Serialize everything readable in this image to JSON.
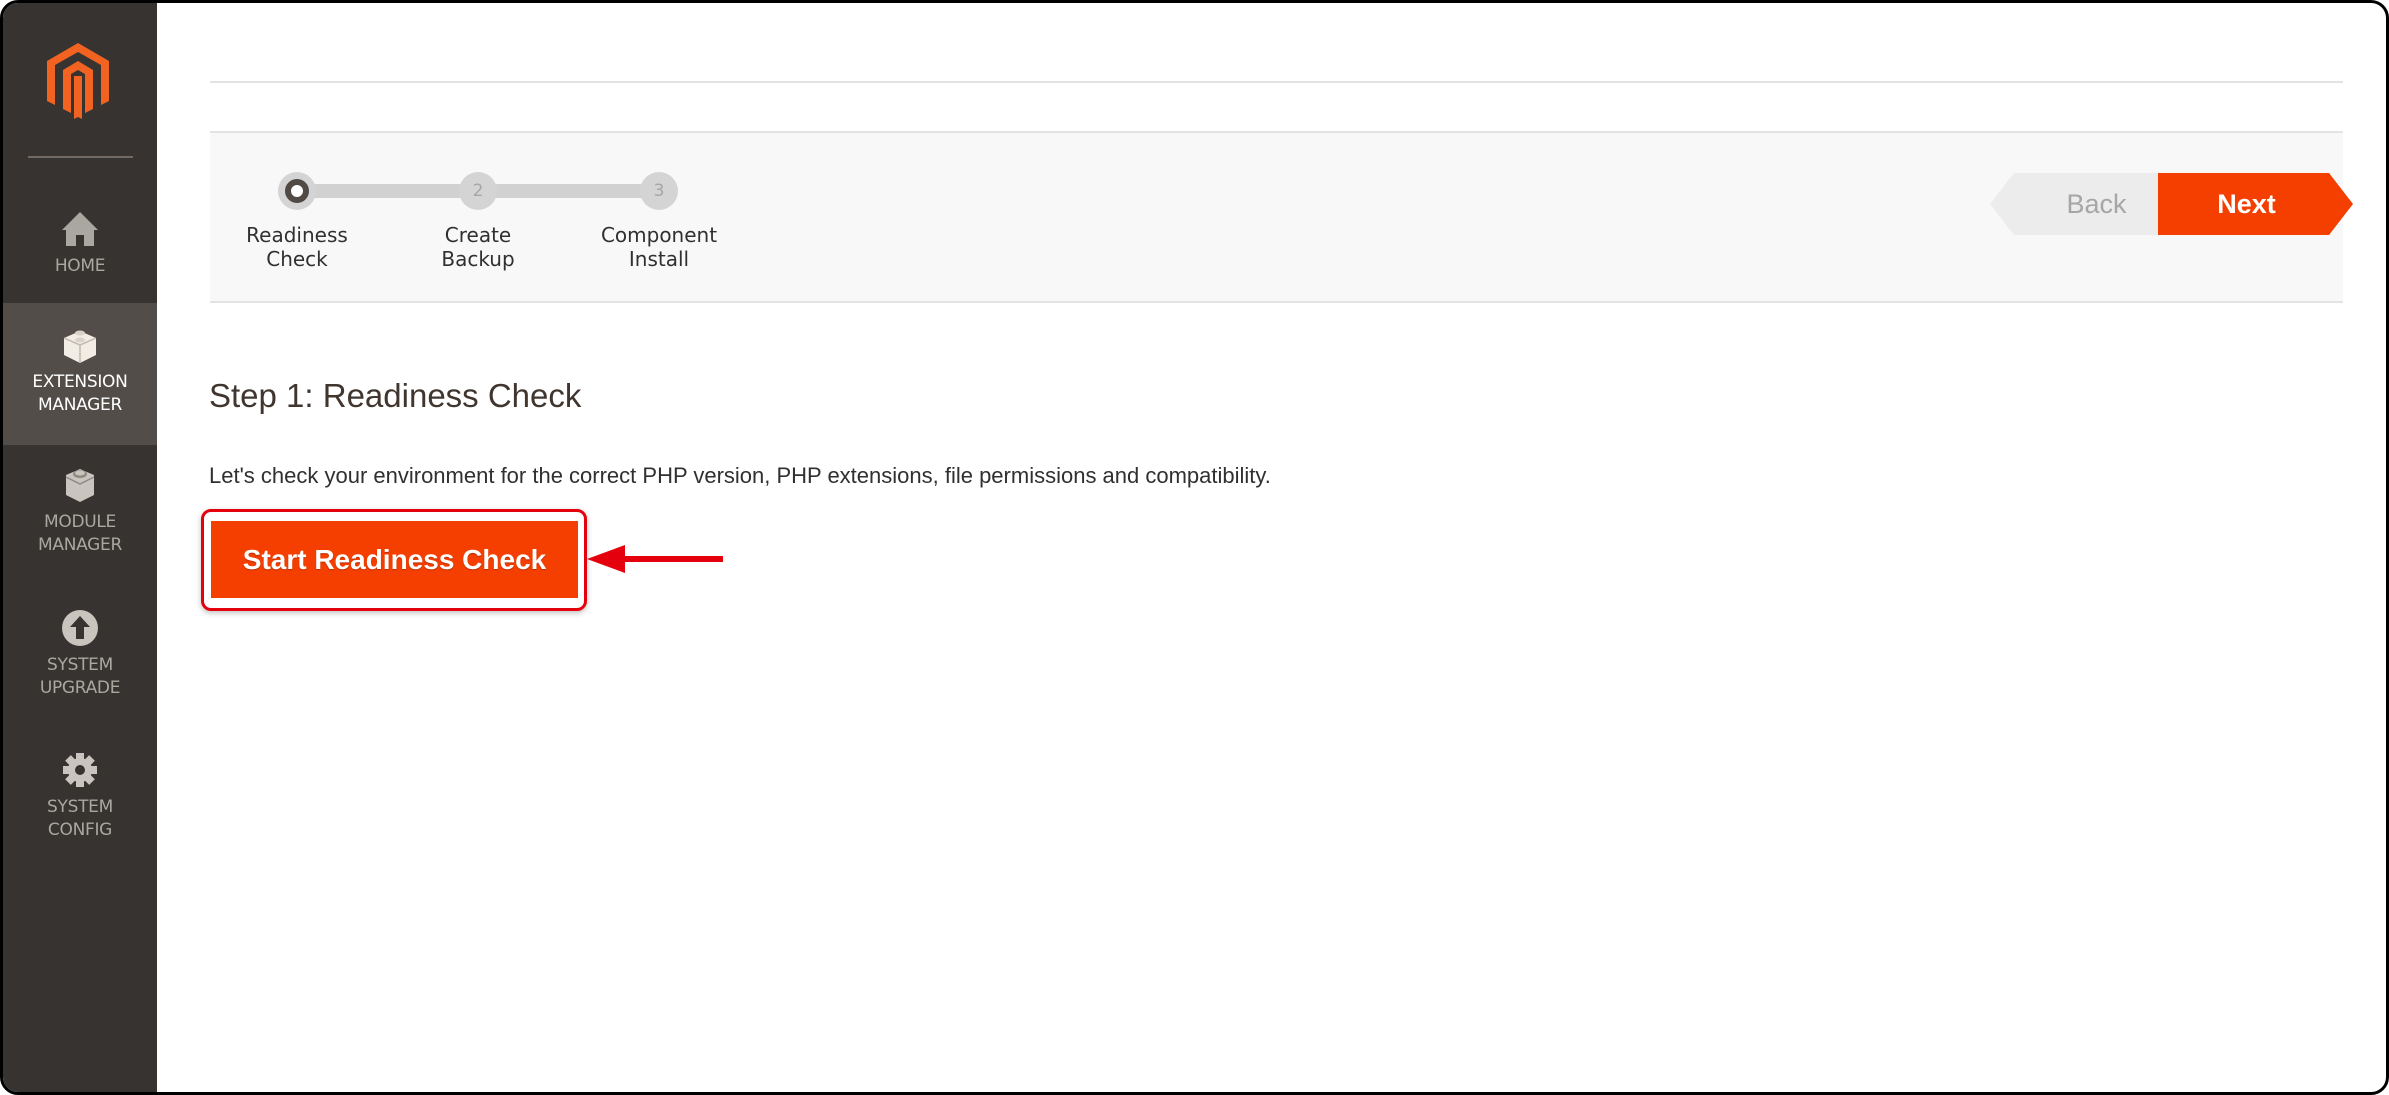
{
  "sidebar": {
    "logo": "magento-logo",
    "items": [
      {
        "label_line1": "HOME",
        "label_line2": "",
        "icon": "home-icon",
        "active": false
      },
      {
        "label_line1": "EXTENSION",
        "label_line2": "MANAGER",
        "icon": "lego-brick-icon",
        "active": true
      },
      {
        "label_line1": "MODULE",
        "label_line2": "MANAGER",
        "icon": "cube-icon",
        "active": false
      },
      {
        "label_line1": "SYSTEM",
        "label_line2": "UPGRADE",
        "icon": "upload-arrow-icon",
        "active": false
      },
      {
        "label_line1": "SYSTEM",
        "label_line2": "CONFIG",
        "icon": "gear-icon",
        "active": false
      }
    ]
  },
  "wizard": {
    "steps": [
      {
        "number": "1",
        "line1": "Readiness",
        "line2": "Check",
        "state": "current"
      },
      {
        "number": "2",
        "line1": "Create",
        "line2": "Backup",
        "state": "pending"
      },
      {
        "number": "3",
        "line1": "Component",
        "line2": "Install",
        "state": "pending"
      }
    ],
    "back_label": "Back",
    "next_label": "Next"
  },
  "content": {
    "heading": "Step 1: Readiness Check",
    "description": "Let's check your environment for the correct PHP version, PHP extensions, file permissions and compatibility.",
    "start_button_label": "Start Readiness Check"
  },
  "colors": {
    "accent": "#f43f00",
    "sidebar_bg": "#373330",
    "sidebar_active_bg": "#524d49",
    "annotation": "#e5000d"
  }
}
